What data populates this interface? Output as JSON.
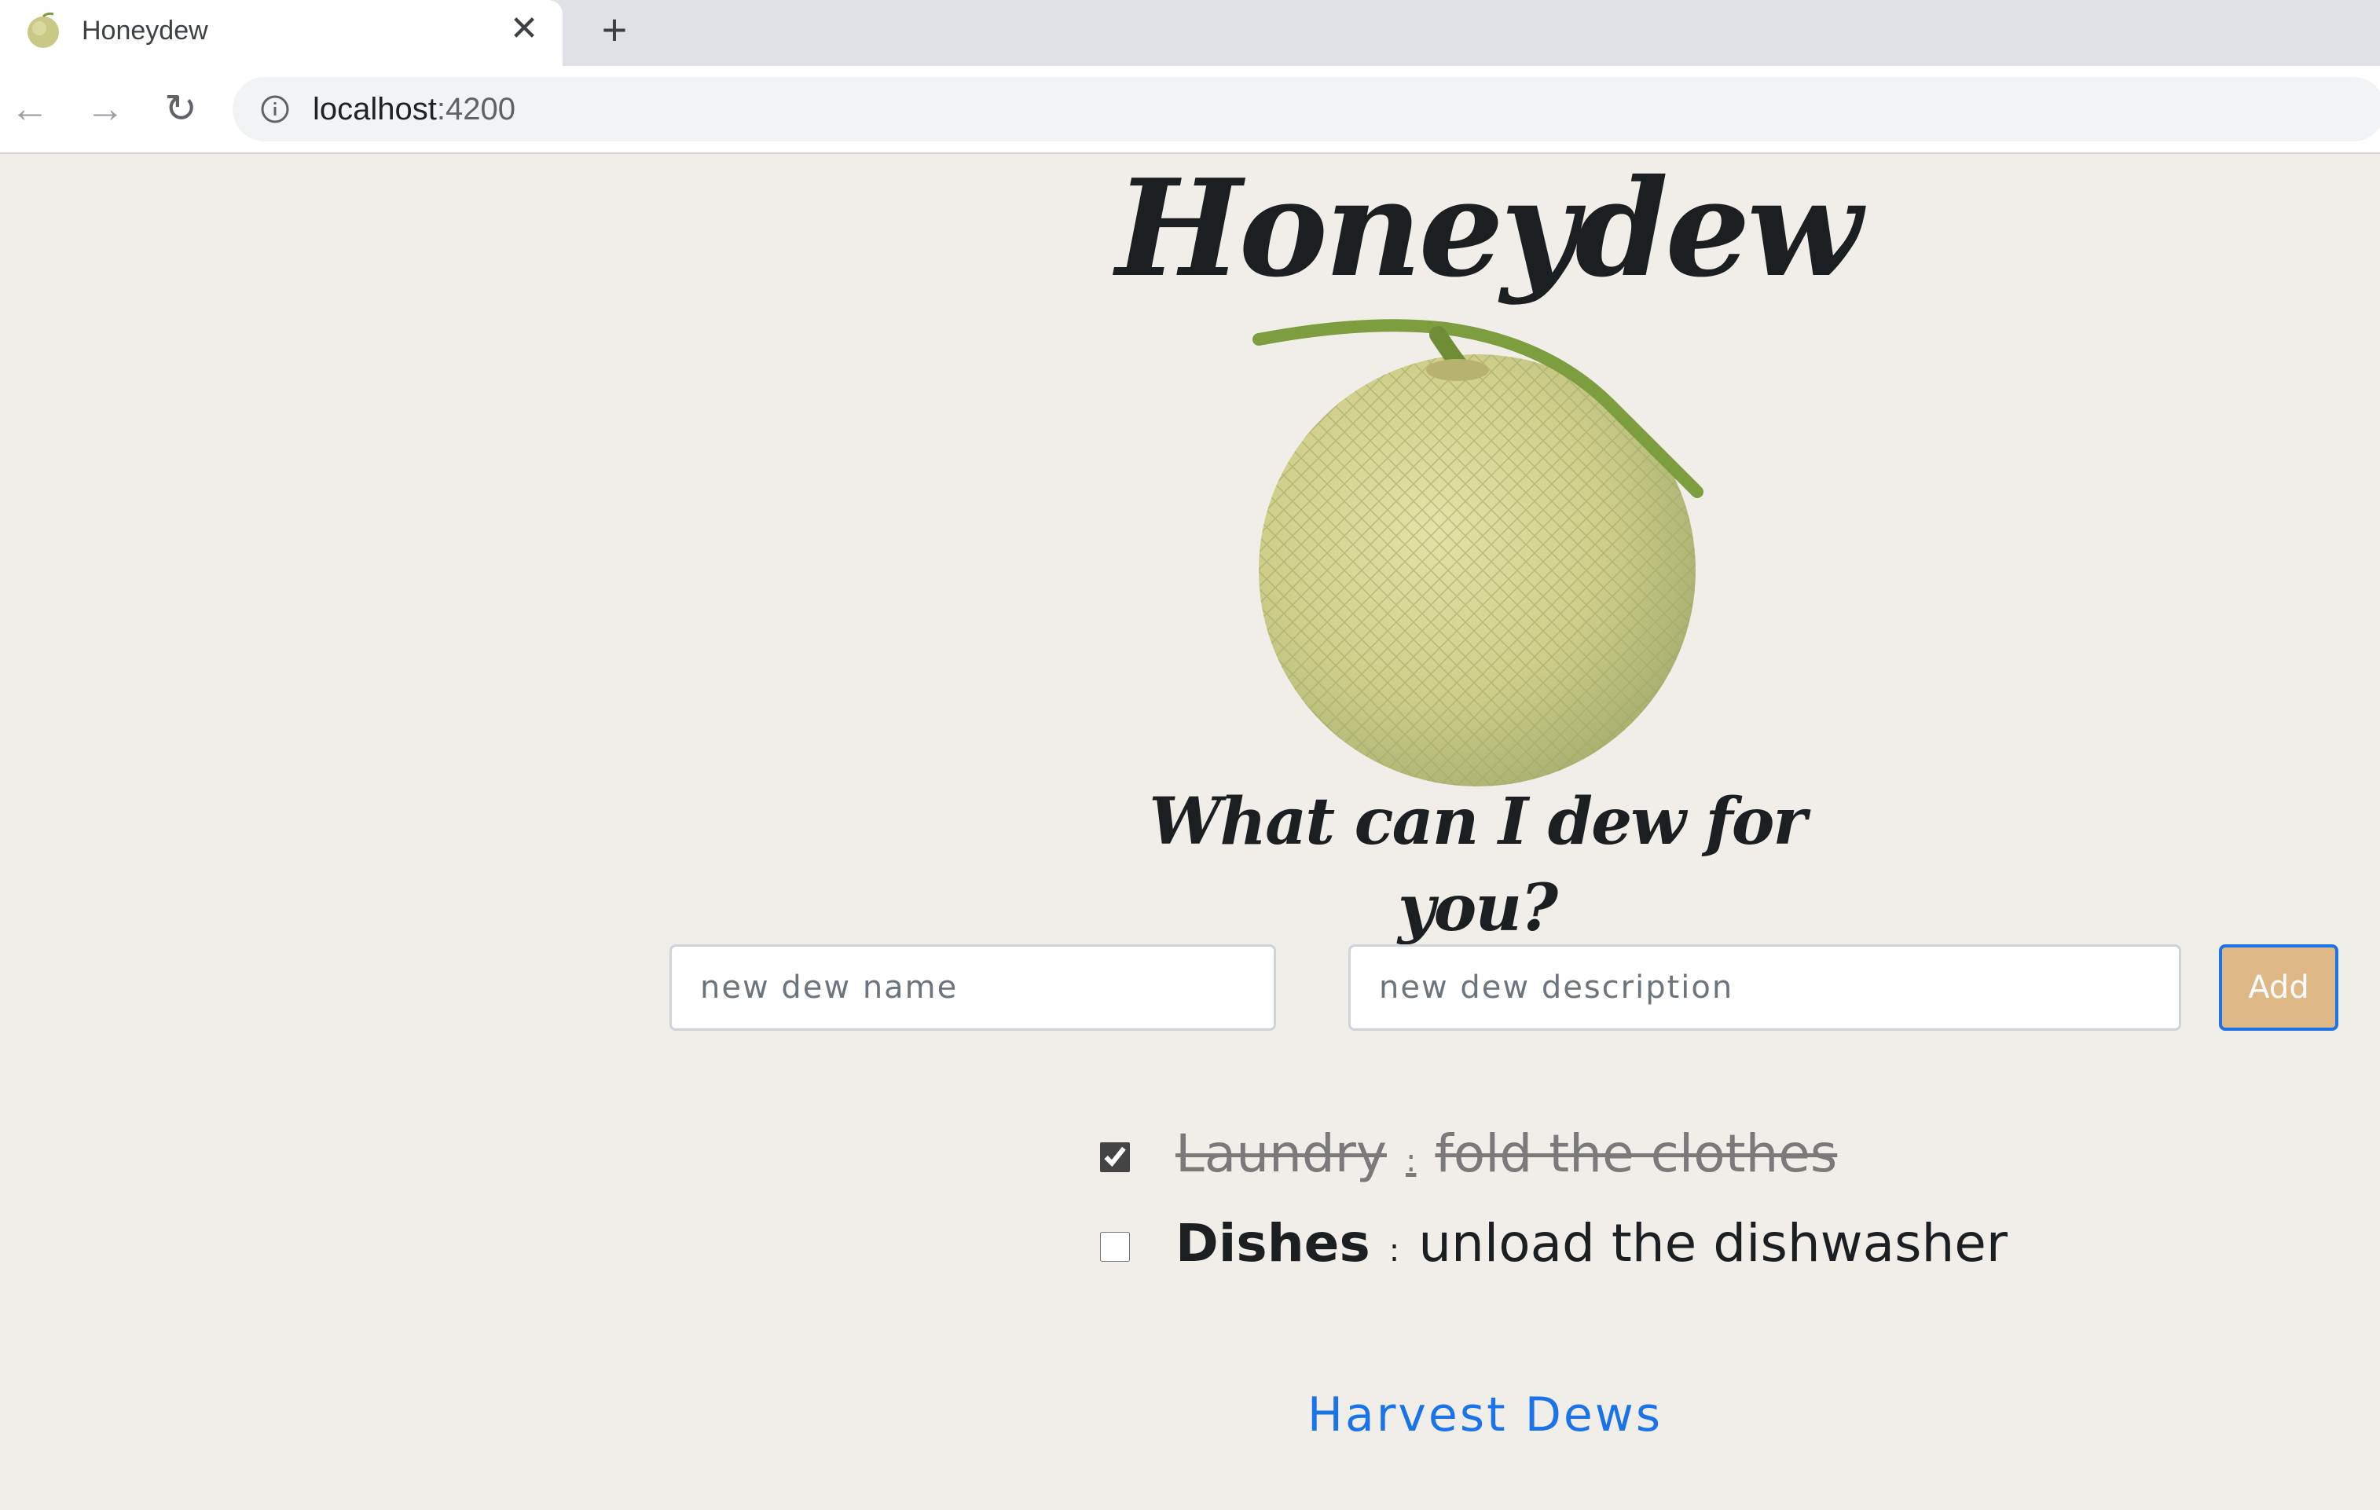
{
  "browser": {
    "tab_title": "Honeydew",
    "close_glyph": "✕",
    "new_tab_glyph": "+",
    "back_glyph": "←",
    "forward_glyph": "→",
    "reload_glyph": "↻",
    "url_host": "localhost",
    "url_port": ":4200"
  },
  "header": {
    "title": "Honeydew",
    "tagline": "What can I dew for you?",
    "image": "honeydew-melon-image"
  },
  "form": {
    "name_placeholder": "new dew name",
    "name_value": "",
    "description_placeholder": "new dew description",
    "description_value": "",
    "add_label": "Add"
  },
  "dews": [
    {
      "name": "Laundry",
      "separator": ":",
      "description": "fold the clothes",
      "done": true
    },
    {
      "name": "Dishes",
      "separator": ":",
      "description": "unload the dishwasher",
      "done": false
    }
  ],
  "footer": {
    "harvest_label": "Harvest Dews"
  },
  "colors": {
    "page_bg": "#f1eeea",
    "add_button": "#deb887",
    "link": "#1a73e8"
  }
}
